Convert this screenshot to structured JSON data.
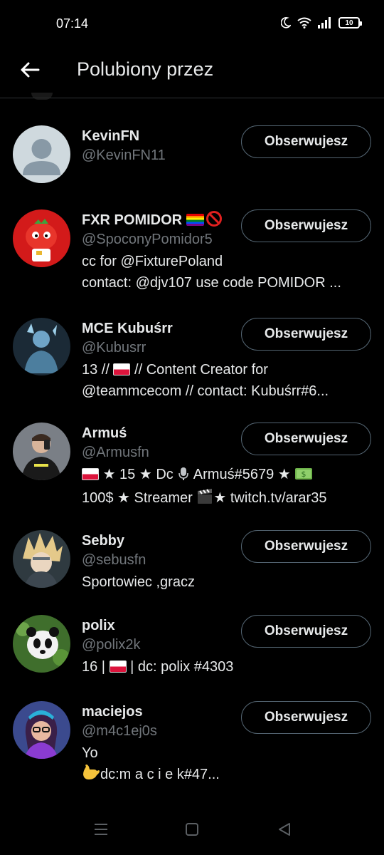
{
  "status_bar": {
    "time": "07:14",
    "battery": "10",
    "icons": [
      "moon-icon",
      "wifi-icon",
      "signal-icon",
      "battery-icon"
    ]
  },
  "header": {
    "back_icon": "arrow-left-icon",
    "title": "Polubiony przez"
  },
  "users": [
    {
      "name": "KevinFN",
      "handle": "@KevinFN11",
      "bio": [],
      "button": "Obserwujesz"
    },
    {
      "name": "FXR POMIDOR",
      "handle": "@SpoconyPomidor5",
      "bio": [
        "cc for @FixturePoland",
        "contact: @djv107 use code POMIDOR ..."
      ],
      "button": "Obserwujesz"
    },
    {
      "name": "MCE Kubuśrr",
      "handle": "@Kubusrr",
      "bio_line1_a": "13 //",
      "bio_line1_b": "// Content Creator for",
      "bio_line2": "@teammcecom // contact: Kubuśrr#6...",
      "button": "Obserwujesz"
    },
    {
      "name": "Armuś",
      "handle": "@Armusfn",
      "bio_line1_a": "★ 15 ★ Dc",
      "bio_line1_b": "Armuś#5679 ★",
      "bio_line2_a": "100$ ★ Streamer",
      "bio_line2_b": "★ twitch.tv/arar35",
      "button": "Obserwujesz"
    },
    {
      "name": "Sebby",
      "handle": "@sebusfn",
      "bio": [
        "Sportowiec ,gracz"
      ],
      "button": "Obserwujesz"
    },
    {
      "name": "polix",
      "handle": "@polix2k",
      "bio_line1_a": "16 |",
      "bio_line1_b": "| dc: polix #4303",
      "button": "Obserwujesz"
    },
    {
      "name": "maciejos",
      "handle": "@m4c1ej0s",
      "bio_line1": "Yo",
      "bio_line2": "dc:m a c i e k#47...",
      "button": "Obserwujesz"
    }
  ],
  "nav_bar": {
    "icons": [
      "recents-icon",
      "home-icon",
      "back-triangle-icon"
    ]
  },
  "colors": {
    "background": "#000000",
    "primary_text": "#e7e9ea",
    "secondary_text": "#71767b",
    "button_border": "#536471",
    "divider": "#2f3336"
  }
}
